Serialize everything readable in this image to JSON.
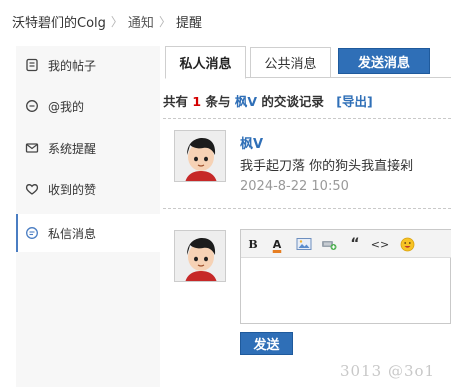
{
  "breadcrumb": {
    "items": [
      "沃特碧们的Colg",
      "通知",
      "提醒"
    ],
    "separator": "〉"
  },
  "sidebar": {
    "items": [
      {
        "label": "我的帖子",
        "icon": "doc-icon"
      },
      {
        "label": "@我的",
        "icon": "chat-bubble-icon"
      },
      {
        "label": "系统提醒",
        "icon": "mail-icon"
      },
      {
        "label": "收到的赞",
        "icon": "heart-icon"
      },
      {
        "label": "私信消息",
        "icon": "message-icon",
        "active": true
      }
    ]
  },
  "tabs": {
    "private": "私人消息",
    "public": "公共消息",
    "send": "发送消息"
  },
  "summary": {
    "prefix": "共有",
    "count": "1",
    "middle": "条与",
    "user": "枫V",
    "suffix": "的交谈记录",
    "export": "[导出]"
  },
  "message": {
    "author": "枫V",
    "text": "我手起刀落 你的狗头我直接剁",
    "time": "2024-8-22 10:50"
  },
  "editor": {
    "toolbar": [
      "B",
      "A",
      "image-icon",
      "attach-icon",
      "“",
      "<>",
      "smiley-icon"
    ],
    "send_label": "发送"
  },
  "watermark": "3013 @3o1",
  "colors": {
    "accent": "#2f6fb7",
    "count": "#d40000"
  }
}
